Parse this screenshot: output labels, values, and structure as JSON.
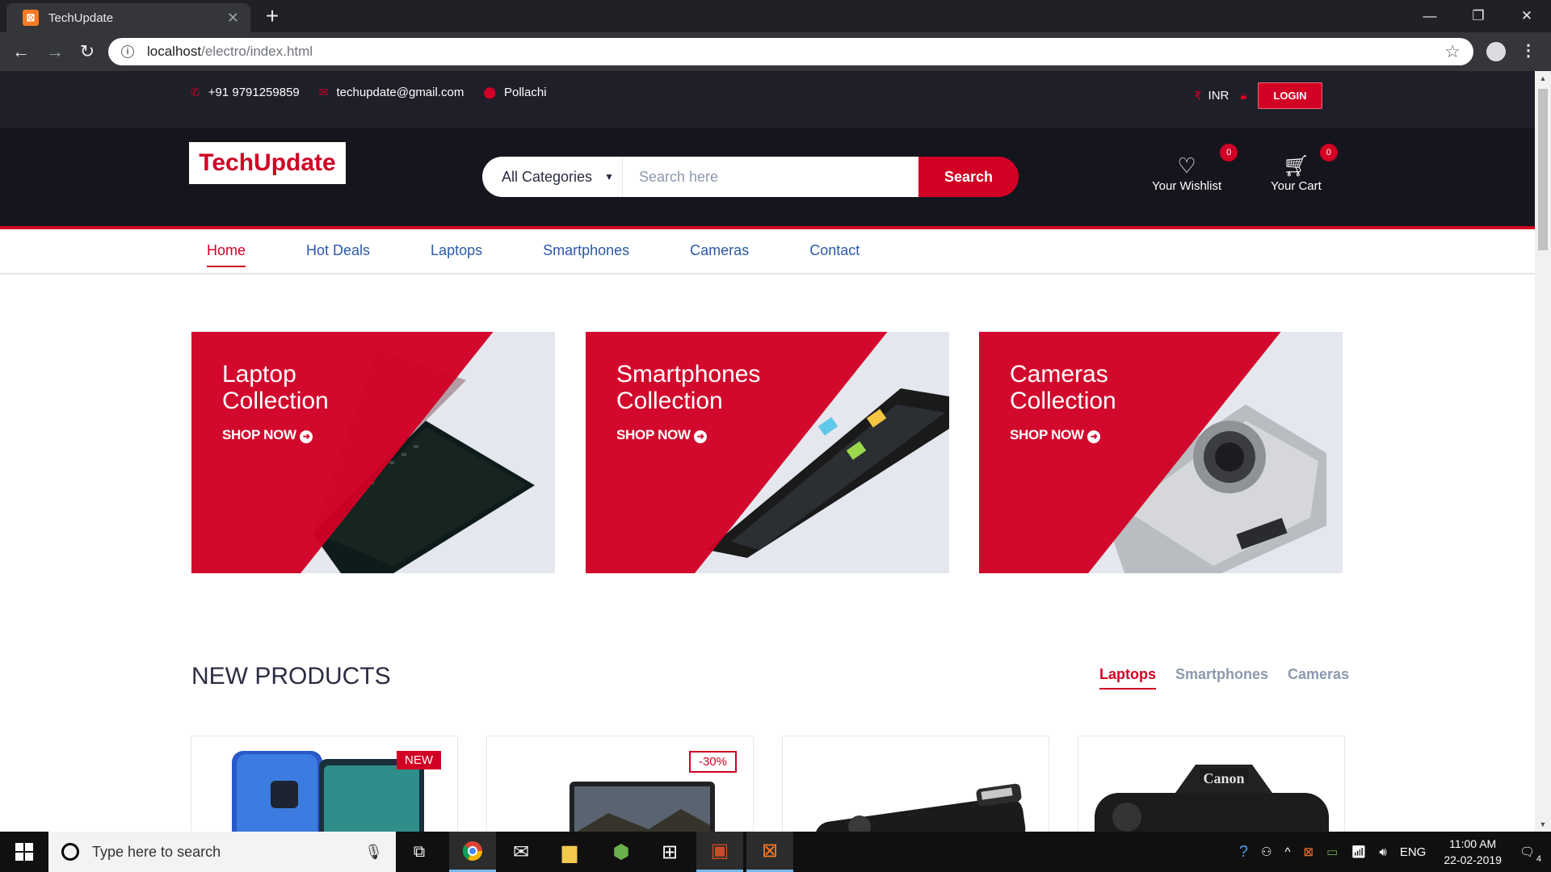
{
  "browser": {
    "tab_title": "TechUpdate",
    "url_host": "localhost",
    "url_path": "/electro/index.html"
  },
  "top_header": {
    "phone": "+91 9791259859",
    "email": "techupdate@gmail.com",
    "location": "Pollachi",
    "currency": "INR",
    "login_label": "LOGIN"
  },
  "header": {
    "logo_text": "TechUpdate",
    "category_selected": "All Categories",
    "search_placeholder": "Search here",
    "search_button": "Search",
    "wishlist_label": "Your Wishlist",
    "wishlist_qty": "0",
    "cart_label": "Your Cart",
    "cart_qty": "0"
  },
  "nav": {
    "items": [
      {
        "label": "Home",
        "active": true
      },
      {
        "label": "Hot Deals"
      },
      {
        "label": "Laptops"
      },
      {
        "label": "Smartphones"
      },
      {
        "label": "Cameras"
      },
      {
        "label": "Contact"
      }
    ]
  },
  "shops": [
    {
      "title_line1": "Laptop",
      "title_line2": "Collection",
      "cta": "SHOP NOW"
    },
    {
      "title_line1": "Smartphones",
      "title_line2": "Collection",
      "cta": "SHOP NOW"
    },
    {
      "title_line1": "Cameras",
      "title_line2": "Collection",
      "cta": "SHOP NOW"
    }
  ],
  "new_products": {
    "title": "NEW PRODUCTS",
    "tabs": [
      "Laptops",
      "Smartphones",
      "Cameras"
    ],
    "active_tab": "Laptops",
    "labels": [
      "NEW",
      "-30%"
    ]
  },
  "taskbar": {
    "search_placeholder": "Type here to search",
    "lang": "ENG",
    "time": "11:00 AM",
    "date": "22-02-2019",
    "notification_count": "4"
  },
  "colors": {
    "accent": "#D10024",
    "header_dark": "#15161D",
    "top_bar": "#1E1F29"
  }
}
